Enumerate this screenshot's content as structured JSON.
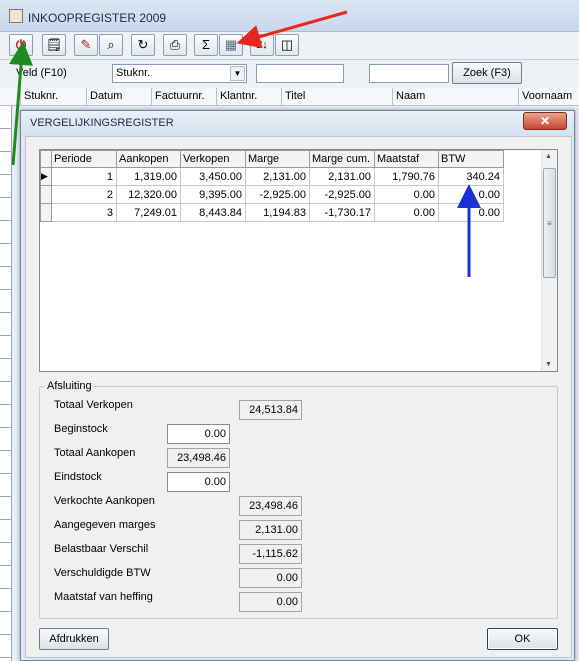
{
  "app": {
    "title": "INKOOPREGISTER 2009"
  },
  "toolbar": {
    "buttons": [
      {
        "name": "power-icon",
        "glyph": "⏻"
      },
      {
        "name": "properties-icon",
        "glyph": "🗒"
      },
      {
        "name": "pencil-icon",
        "glyph": "✎"
      },
      {
        "name": "binoculars-icon",
        "glyph": "⌕"
      },
      {
        "name": "refresh-icon",
        "glyph": "↻"
      },
      {
        "name": "printer-icon",
        "glyph": "⎙"
      },
      {
        "name": "sum-icon",
        "glyph": "Σ"
      },
      {
        "name": "calculator-icon",
        "glyph": "▦"
      },
      {
        "name": "sort-icon",
        "glyph": "2↓"
      },
      {
        "name": "columns-icon",
        "glyph": "◫"
      }
    ]
  },
  "search": {
    "field_label": "Veld (F10)",
    "field_value": "Stuknr.",
    "find_button": "Zoek (F3)"
  },
  "list": {
    "columns": [
      "Stuknr.",
      "Datum",
      "Factuurnr.",
      "Klantnr.",
      "Titel",
      "Naam",
      "Voornaam"
    ]
  },
  "dialog": {
    "title": "VERGELIJKINGSREGISTER",
    "close_label": "✕",
    "table": {
      "headers": [
        "Periode",
        "Aankopen",
        "Verkopen",
        "Marge",
        "Marge cum.",
        "Maatstaf",
        "BTW"
      ],
      "rows": [
        [
          "1",
          "1,319.00",
          "3,450.00",
          "2,131.00",
          "2,131.00",
          "1,790.76",
          "340.24"
        ],
        [
          "2",
          "12,320.00",
          "9,395.00",
          "-2,925.00",
          "-2,925.00",
          "0.00",
          "0.00"
        ],
        [
          "3",
          "7,249.01",
          "8,443.84",
          "1,194.83",
          "-1,730.17",
          "0.00",
          "0.00"
        ]
      ]
    },
    "closing": {
      "legend": "Afsluiting",
      "totaal_verkopen": {
        "label": "Totaal Verkopen",
        "value": "24,513.84"
      },
      "beginstock": {
        "label": "Beginstock",
        "value": "0.00"
      },
      "totaal_aankopen": {
        "label": "Totaal Aankopen",
        "value": "23,498.46"
      },
      "eindstock": {
        "label": "Eindstock",
        "value": "0.00"
      },
      "verkochte_aankopen": {
        "label": "Verkochte Aankopen",
        "value": "23,498.46"
      },
      "aangegeven_marges": {
        "label": "Aangegeven marges",
        "value": "2,131.00"
      },
      "belastbaar_verschil": {
        "label": "Belastbaar Verschil",
        "value": "-1,115.62"
      },
      "verschuldigde_btw": {
        "label": "Verschuldigde BTW",
        "value": "0.00"
      },
      "maatstaf_heffing": {
        "label": "Maatstaf van heffing",
        "value": "0.00"
      }
    },
    "print_button": "Afdrukken",
    "ok_button": "OK"
  },
  "annotations": {
    "red": "#e8271f",
    "green": "#1f8a1f",
    "blue": "#1f2fd6"
  }
}
